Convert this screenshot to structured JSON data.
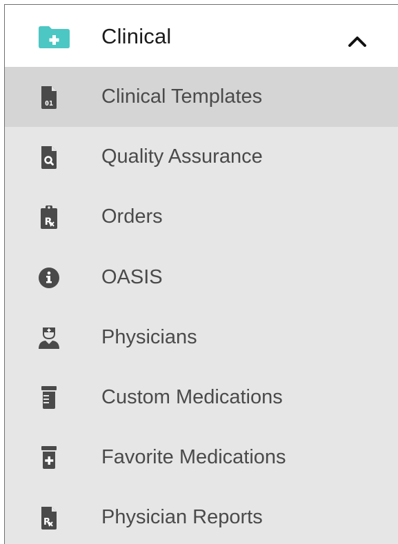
{
  "header": {
    "title": "Clinical",
    "folder_icon": "folder-plus-icon",
    "toggle_icon": "chevron-up-icon",
    "accent_color": "#4cc7c3"
  },
  "menu": {
    "items": [
      {
        "label": "Clinical Templates",
        "icon": "file-binary-icon",
        "active": true
      },
      {
        "label": "Quality Assurance",
        "icon": "file-search-icon",
        "active": false
      },
      {
        "label": "Orders",
        "icon": "clipboard-prescription-icon",
        "active": false
      },
      {
        "label": "OASIS",
        "icon": "info-circle-icon",
        "active": false
      },
      {
        "label": "Physicians",
        "icon": "user-nurse-icon",
        "active": false
      },
      {
        "label": "Custom Medications",
        "icon": "prescription-bottle-icon",
        "active": false
      },
      {
        "label": "Favorite Medications",
        "icon": "prescription-bottle-medical-icon",
        "active": false
      },
      {
        "label": "Physician Reports",
        "icon": "file-prescription-icon",
        "active": false
      }
    ]
  },
  "colors": {
    "icon": "#4a4a4a",
    "active_row": "#d5d5d5",
    "panel_bg": "#e6e6e6"
  }
}
